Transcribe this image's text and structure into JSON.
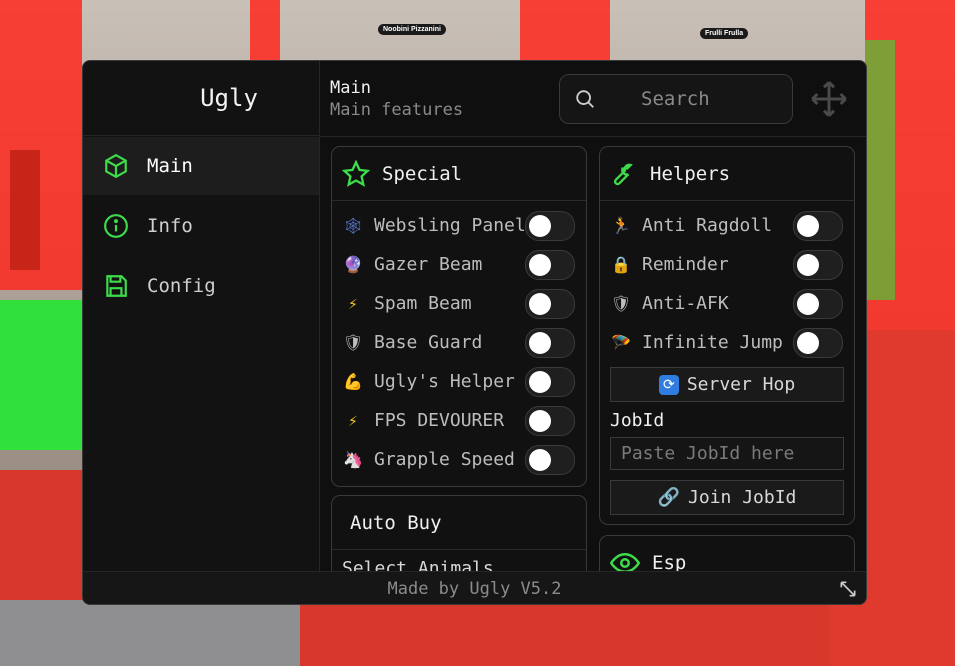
{
  "app": {
    "title": "Ugly",
    "footer": "Made by Ugly V5.2"
  },
  "accent": "#3ddc4b",
  "sidebar": {
    "items": [
      {
        "label": "Main",
        "icon": "cube-icon"
      },
      {
        "label": "Info",
        "icon": "info-icon"
      },
      {
        "label": "Config",
        "icon": "save-icon"
      }
    ]
  },
  "header": {
    "title": "Main",
    "subtitle": "Main features",
    "search_placeholder": "Search"
  },
  "background": {
    "tag1": "Noobini Pizzanini",
    "tag2": "Frulli Frulla"
  },
  "special": {
    "title": "Special",
    "items": [
      {
        "label": "Websling Panel",
        "icon": "web-icon",
        "on": false
      },
      {
        "label": "Gazer Beam",
        "icon": "eye-orb-icon",
        "on": false
      },
      {
        "label": "Spam Beam",
        "icon": "lightning-icon",
        "on": false
      },
      {
        "label": "Base Guard",
        "icon": "shield-icon",
        "on": false
      },
      {
        "label": "Ugly's Helper",
        "icon": "arm-icon",
        "on": false
      },
      {
        "label": "FPS DEVOURER",
        "icon": "lightning-icon",
        "on": false
      },
      {
        "label": "Grapple Speed",
        "icon": "unicorn-icon",
        "on": false
      }
    ]
  },
  "helpers": {
    "title": "Helpers",
    "items": [
      {
        "label": "Anti Ragdoll",
        "icon": "runner-icon",
        "on": false
      },
      {
        "label": "Reminder",
        "icon": "lock-icon",
        "on": false
      },
      {
        "label": "Anti-AFK",
        "icon": "shield-icon",
        "on": false
      },
      {
        "label": "Infinite Jump",
        "icon": "parachute-icon",
        "on": false
      }
    ],
    "server_hop": "Server Hop",
    "jobid_label": "JobId",
    "jobid_placeholder": "Paste JobId here",
    "join_jobid": "Join JobId"
  },
  "autobuy": {
    "title": "Auto Buy",
    "select_label": "Select Animals"
  },
  "esp": {
    "title": "Esp"
  }
}
